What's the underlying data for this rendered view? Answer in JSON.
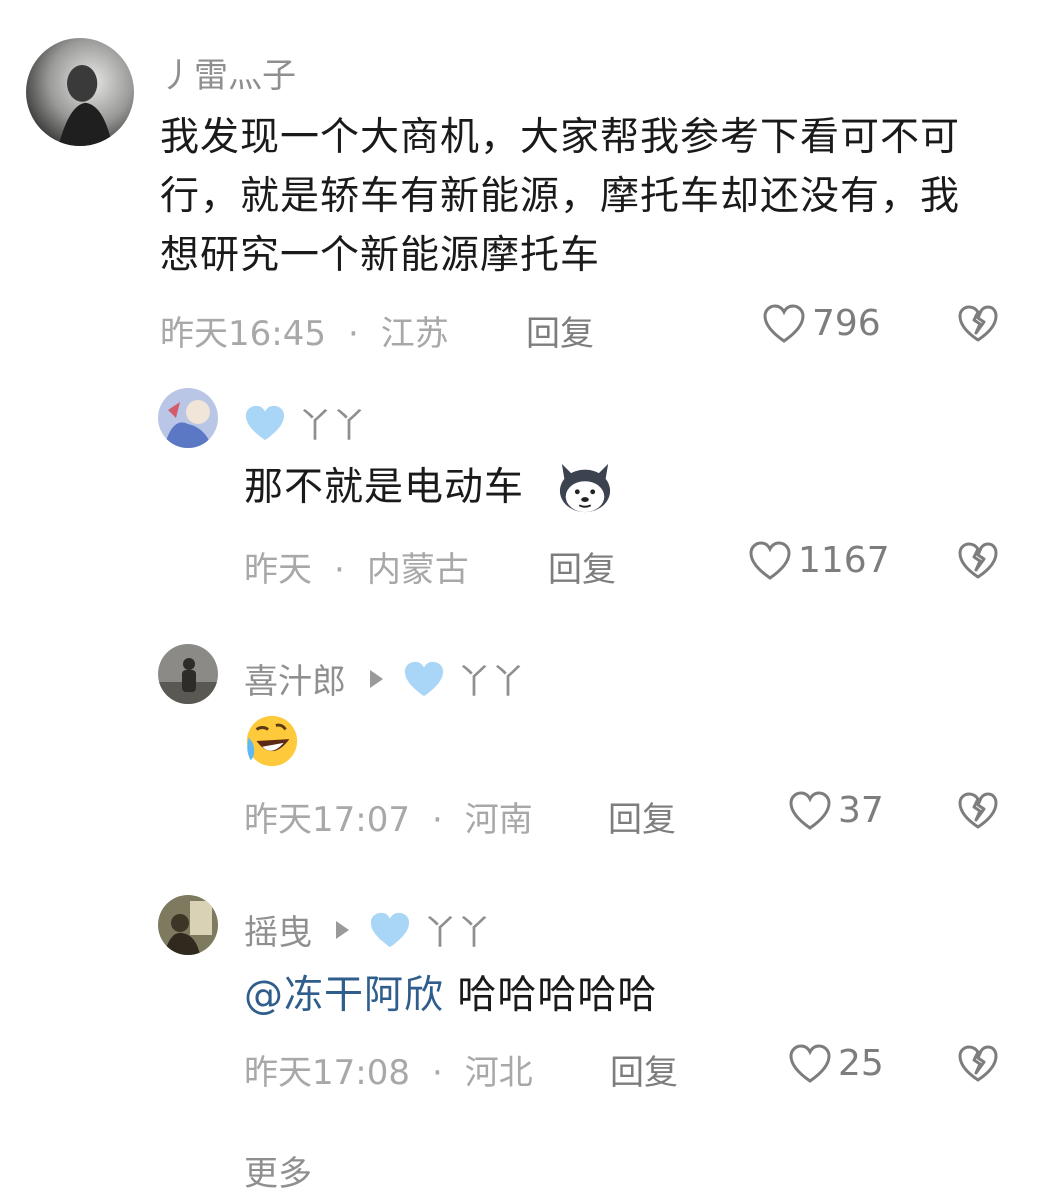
{
  "comments": [
    {
      "username": "丿雷灬子",
      "text": "我发现一个大商机，大家帮我参考下看可不可行，就是轿车有新能源，摩托车却还没有，我想研究一个新能源摩托车",
      "time": "昨天16:45",
      "location": "江苏",
      "reply_label": "回复",
      "likes": "796"
    },
    {
      "username": "丫丫",
      "text": "那不就是电动车",
      "emoji": "husky-face",
      "time": "昨天",
      "location": "内蒙古",
      "reply_label": "回复",
      "likes": "1167"
    },
    {
      "username": "喜汁郎",
      "reply_to": "丫丫",
      "emoji": "laughing-tears-face",
      "time": "昨天17:07",
      "location": "河南",
      "reply_label": "回复",
      "likes": "37"
    },
    {
      "username": "摇曳",
      "reply_to": "丫丫",
      "mention": "@冻干阿欣",
      "text": " 哈哈哈哈哈",
      "time": "昨天17:08",
      "location": "河北",
      "reply_label": "回复",
      "likes": "25"
    }
  ],
  "more_hint": "更多",
  "separator": "·",
  "colors": {
    "username": "#8f8f8f",
    "meta": "#a8a8a8",
    "mention": "#2f5d8c",
    "heart_badge": "#9fd0f5"
  }
}
